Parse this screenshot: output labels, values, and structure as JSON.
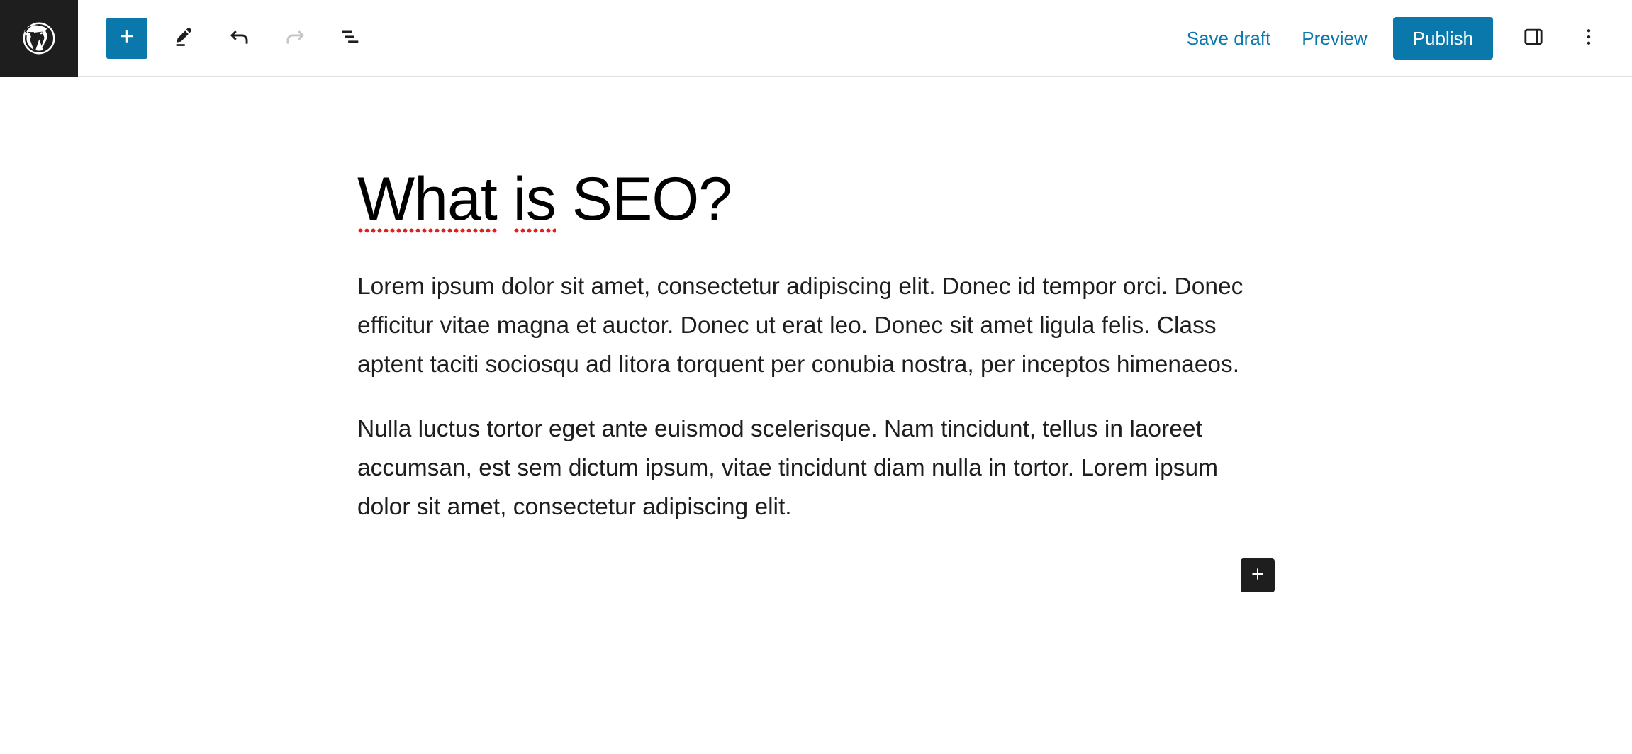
{
  "header": {
    "logo_icon": "wordpress-logo-icon",
    "left_tools": [
      {
        "name": "block-inserter",
        "icon": "plus-icon",
        "label": "Toggle block inserter"
      },
      {
        "name": "edit-mode-tool",
        "icon": "pencil-icon",
        "label": "Tools"
      },
      {
        "name": "undo-tool",
        "icon": "undo-arrow-icon",
        "label": "Undo",
        "disabled": false
      },
      {
        "name": "redo-tool",
        "icon": "redo-arrow-icon",
        "label": "Redo",
        "disabled": true
      },
      {
        "name": "list-view-tool",
        "icon": "list-view-icon",
        "label": "List view"
      }
    ],
    "save_draft_label": "Save draft",
    "preview_label": "Preview",
    "publish_label": "Publish",
    "sidebar_toggle_icon": "sidebar-panel-icon",
    "more_menu_icon": "three-dots-vertical-icon"
  },
  "editor": {
    "title": {
      "full_text": "What is SEO?",
      "segments": [
        {
          "text": "What",
          "spellcheck": true
        },
        {
          "text": " ",
          "spellcheck": false
        },
        {
          "text": "is",
          "spellcheck": true
        },
        {
          "text": " SEO?",
          "spellcheck": false
        }
      ]
    },
    "paragraphs": [
      {
        "full_text": "Lorem ipsum dolor sit amet, consectetur adipiscing elit. Donec id tempor orci. Donec efficitur vitae magna et auctor. Donec ut erat leo. Donec sit amet ligula felis. Class aptent taciti sociosqu ad litora torquent per conubia nostra, per inceptos himenaeos.",
        "segments": [
          {
            "text": "Lorem ipsum dolor sit amet, consectetur adipiscing elit. Donec id tempor orci. Donec efficitur",
            "spellcheck": true
          },
          {
            "text": " vitae magna et ",
            "spellcheck": false
          },
          {
            "text": "auctor. Donec",
            "spellcheck": true
          },
          {
            "text": " ut ",
            "spellcheck": false
          },
          {
            "text": "erat leo. Donec sit amet ligula felis. Class aptent taciti sociosqu",
            "spellcheck": true
          },
          {
            "text": " ad ",
            "spellcheck": false
          },
          {
            "text": "litora torquent per conubia nostra",
            "spellcheck": true
          },
          {
            "text": ", ",
            "spellcheck": false
          },
          {
            "text": "per inceptos himenaeos.",
            "spellcheck": true
          }
        ]
      },
      {
        "full_text": "Nulla luctus tortor eget ante euismod scelerisque. Nam tincidunt, tellus in laoreet accumsan, est sem dictum ipsum, vitae tincidunt diam nulla in tortor. Lorem ipsum dolor sit amet, consectetur adipiscing elit.",
        "segments": [
          {
            "text": "Nulla luctus tortor eget",
            "spellcheck": true
          },
          {
            "text": " ante ",
            "spellcheck": false
          },
          {
            "text": "euismod scelerisque. Nam tincidunt, tellus",
            "spellcheck": true
          },
          {
            "text": " in ",
            "spellcheck": false
          },
          {
            "text": "laoreet accumsan,",
            "spellcheck": true
          },
          {
            "text": " est ",
            "spellcheck": false
          },
          {
            "text": "sem dictum ipsum,",
            "spellcheck": true
          },
          {
            "text": " vitae ",
            "spellcheck": false
          },
          {
            "text": "tincidunt diam nulla",
            "spellcheck": true
          },
          {
            "text": " in ",
            "spellcheck": false
          },
          {
            "text": "tortor. Lorem ipsum dolor sit amet, consectetur adipiscing elit.",
            "spellcheck": true
          }
        ]
      }
    ],
    "block_appender_icon": "plus-icon"
  },
  "colors": {
    "wp_blue": "#0b78ab",
    "dark": "#1e1e1e",
    "spellcheck_red": "#e02020",
    "border_gray": "#e0e0e0",
    "disabled_gray": "#c5c5c5"
  }
}
